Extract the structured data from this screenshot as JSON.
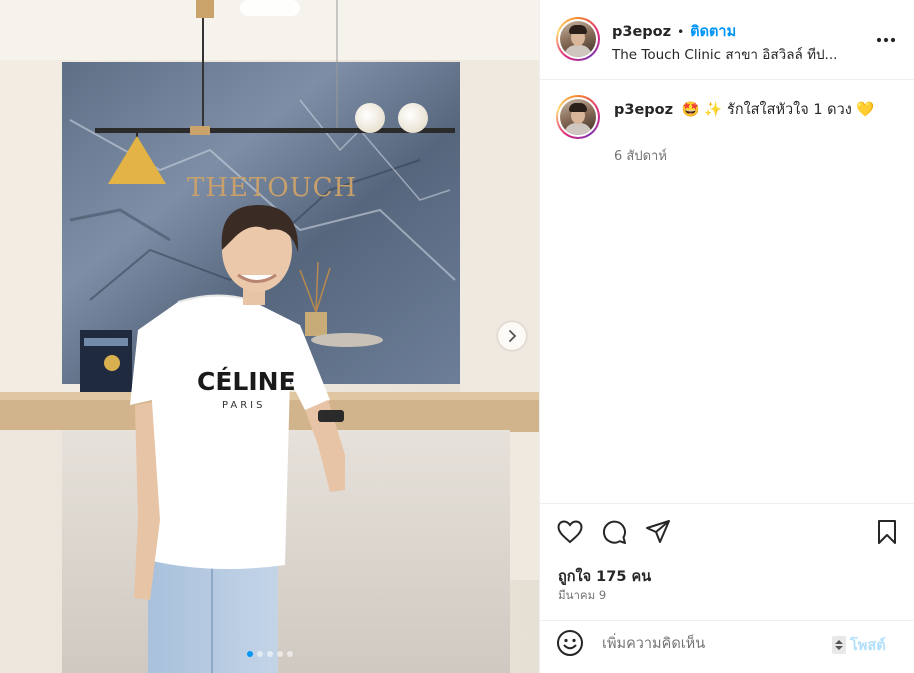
{
  "post": {
    "username": "p3epoz",
    "separator": "•",
    "follow_label": "ติดตาม",
    "location": "The Touch Clinic สาขา อิสวิลล์ ทีป..."
  },
  "caption": {
    "username": "p3epoz",
    "text": "🤩 ✨ รักใสใสหัวใจ 1 ดวง 💛",
    "time": "6 สัปดาห์"
  },
  "stats": {
    "likes": "ถูกใจ 175 คน",
    "date": "มีนาคม 9"
  },
  "comment_box": {
    "placeholder": "เพิ่มความคิดเห็น",
    "post_label": "โพสต์"
  },
  "media": {
    "sign_text": "THETOUCH",
    "shirt_text": "CÉLINE",
    "shirt_subtext": "PARIS",
    "carousel_count": 5,
    "active_index": 0
  },
  "icons": [
    "more-icon",
    "heart-icon",
    "comment-icon",
    "share-icon",
    "bookmark-icon",
    "emoji-icon",
    "chevron-right-icon"
  ],
  "colors": {
    "accent": "#0095f6",
    "text": "#262626",
    "muted": "#737373",
    "post_disabled": "#b2dffc"
  }
}
